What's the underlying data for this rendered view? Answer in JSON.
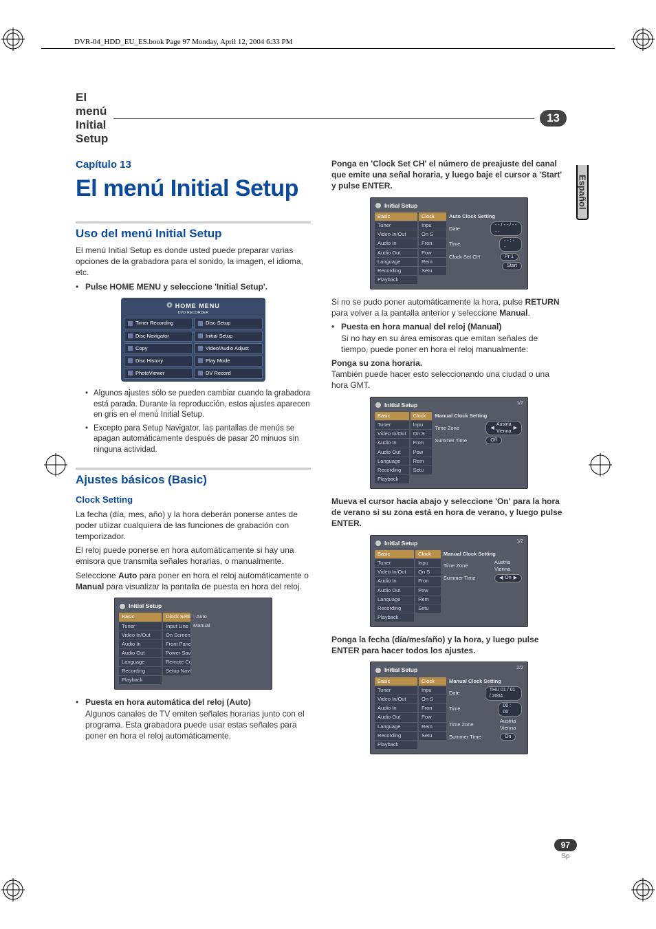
{
  "header_book_info": "DVR-04_HDD_EU_ES.book  Page 97  Monday, April 12, 2004  6:33 PM",
  "section_bar": {
    "title": "El menú Initial Setup",
    "chip": "13"
  },
  "side_tab": "Español",
  "chapter": {
    "label": "Capítulo 13",
    "title": "El menú Initial Setup"
  },
  "left": {
    "h2_uso": "Uso del menú Initial Setup",
    "uso_p1": "El menú Initial Setup es donde usted puede preparar varias opciones de la grabadora para el sonido, la imagen, el idioma, etc.",
    "uso_b1": "Pulse HOME MENU y seleccione 'Initial Setup'.",
    "uso_sub1": "Algunos ajustes sólo se pueden cambiar cuando la grabadora está parada. Durante la reproducción, estos ajustes aparecen en gris en el menú Initial Setup.",
    "uso_sub2": "Excepto para Setup Navigator, las pantallas de menús se apagan automáticamente después de pasar 20 minuos sin ninguna actividad.",
    "h2_basic": "Ajustes básicos (Basic)",
    "h3_clock": "Clock Setting",
    "clock_p1": "La fecha (día, mes, año) y la hora deberán ponerse antes de poder utiizar cualquiera de las funciones de grabación con temporizador.",
    "clock_p2": "El reloj puede ponerse en hora automáticamente si hay una emisora que transmita señales horarias, o manualmente.",
    "clock_p3_a": "Seleccione ",
    "clock_p3_b": "Auto",
    "clock_p3_c": " para poner en hora el reloj automáticamente o ",
    "clock_p3_d": "Manual",
    "clock_p3_e": " para visualizar la pantalla de puesta en hora del reloj.",
    "auto_b_title": "Puesta en hora automática del reloj (Auto)",
    "auto_b_text": "Algunos canales de TV emiten señales horarias junto con el programa. Esta grabadora puede usar estas señales para poner en hora el reloj automáticamente."
  },
  "right": {
    "instr1": "Ponga en 'Clock Set CH' el número de preajuste del canal que emite una señal horaria, y luego baje el cursor a 'Start' y pulse ENTER.",
    "after1_a": "Si no se pudo poner automáticamente la hora, pulse ",
    "after1_b": "RETURN",
    "after1_c": " para volver a la pantalla anterior y seleccione ",
    "after1_d": "Manual",
    "after1_e": ".",
    "manual_b_title": "Puesta en hora manual del reloj (Manual)",
    "manual_b_text": "Si no hay en su área emisoras que emitan señales de tiempo, puede poner en hora el reloj manualmente:",
    "instr2a": "Ponga su zona horaria.",
    "instr2b": "También puede hacer esto seleccionando una ciudad o una hora GMT.",
    "instr3": "Mueva el cursor hacia abajo y seleccione 'On' para la hora de verano si su zona está en hora de verano, y luego pulse ENTER.",
    "instr4": "Ponga la fecha (día/mes/año) y la hora, y luego pulse ENTER para hacer todos los ajustes."
  },
  "home_menu": {
    "title": "HOME MENU",
    "subtitle": "DVD RECORDER",
    "items": [
      "Timer Recording",
      "Disc Setup",
      "Disc Navigator",
      "Initial Setup",
      "Copy",
      "Video/Audio Adjust",
      "Disc History",
      "Play Mode",
      "PhotoViewer",
      "DV Record"
    ]
  },
  "osd_common": {
    "title": "Initial Setup",
    "sidebarA": [
      "Basic",
      "Tuner",
      "Video In/Out",
      "Audio In",
      "Audio Out",
      "Language",
      "Recording",
      "Playback"
    ],
    "sidebarB_trunc": [
      "Clock",
      "Inpu",
      "On S",
      "Fron",
      "Pow",
      "Rem",
      "Setu"
    ]
  },
  "osd1": {
    "colB": [
      "Clock Setting",
      "Input Line System",
      "On Screen Display",
      "Front Panel Display",
      "Power Save",
      "Remote Control Set",
      "Setup Navigator"
    ],
    "opts": [
      "Auto",
      "Manual"
    ]
  },
  "osd2": {
    "heading": "Auto Clock Setting",
    "rows": [
      {
        "label": "Date",
        "value": "- - / - - / - - - -"
      },
      {
        "label": "Time",
        "value": "- - : - -"
      },
      {
        "label": "Clock Set CH",
        "value": "Pr 1"
      }
    ],
    "start": "Start"
  },
  "osd3": {
    "heading": "Manual Clock Setting",
    "page": "1/2",
    "rows": [
      {
        "label": "Time Zone",
        "value": "Austria\nVienna",
        "arrows": true
      },
      {
        "label": "Summer Time",
        "value": "Off"
      }
    ]
  },
  "osd4": {
    "heading": "Manual Clock Setting",
    "page": "1/2",
    "rows": [
      {
        "label": "Time Zone",
        "value": "Austria\nVienna"
      },
      {
        "label": "Summer Time",
        "value": "On",
        "arrows": true
      }
    ]
  },
  "osd5": {
    "heading": "Manual Clock Setting",
    "page": "2/2",
    "rows": [
      {
        "label": "Date",
        "value": "THU  01 / 01 / 2004"
      },
      {
        "label": "Time",
        "value": "00 : 00"
      },
      {
        "label": "Time Zone",
        "value": "Austria\nVienna"
      },
      {
        "label": "Summer Time",
        "value": "On"
      }
    ]
  },
  "footer": {
    "page": "97",
    "lang": "Sp"
  }
}
